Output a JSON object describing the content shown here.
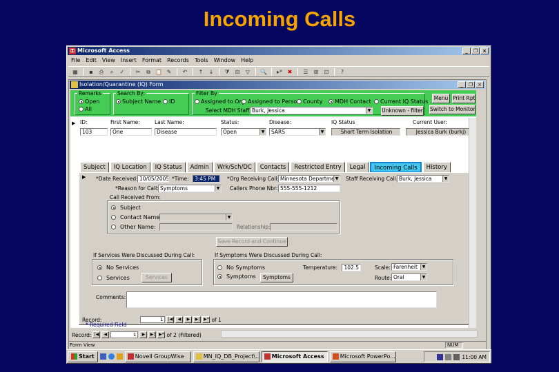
{
  "slide": {
    "title": "Incoming Calls"
  },
  "app": {
    "title": "Microsoft Access"
  },
  "menu": [
    "File",
    "Edit",
    "View",
    "Insert",
    "Format",
    "Records",
    "Tools",
    "Window",
    "Help"
  ],
  "form": {
    "title": "Isolation/Quarantine (IQ) Form",
    "header": {
      "remarks_label": "Remarks",
      "record_options": [
        {
          "label": "Open",
          "checked": true
        },
        {
          "label": "All",
          "checked": false
        }
      ],
      "search_by_label": "Search By:",
      "search_options": [
        {
          "label": "Subject Name",
          "checked": true
        },
        {
          "label": "ID",
          "checked": false
        }
      ],
      "filter_by_label": "Filter By",
      "filter_options": [
        {
          "label": "Assigned to Org",
          "checked": false
        },
        {
          "label": "Assigned to Person",
          "checked": false
        },
        {
          "label": "County",
          "checked": false
        },
        {
          "label": "MDH Contact",
          "checked": true
        },
        {
          "label": "Current IQ Status",
          "checked": false
        }
      ],
      "select_staff_label": "Select MDH Staff:",
      "select_staff_value": "Burk, Jessica",
      "unknown_button": "Unknown - filter",
      "menu_button": "Menu",
      "print_button": "Print Rpt",
      "monitoring_button": "Switch to Monitoring"
    },
    "record_header": {
      "columns": [
        "ID:",
        "First Name:",
        "Last Name:",
        "Status:",
        "Disease:",
        "IQ Status",
        "Current User:"
      ],
      "values": {
        "id": "103",
        "first_name": "One",
        "last_name": "Disease",
        "status": "Open",
        "disease": "SARS",
        "iq_status": "Short Term Isolation",
        "current_user": "Jessica Burk (burkj)"
      }
    },
    "tabs": [
      {
        "label": "Subject",
        "active": false
      },
      {
        "label": "IQ Location",
        "active": false
      },
      {
        "label": "IQ Status",
        "active": false
      },
      {
        "label": "Admin",
        "active": false
      },
      {
        "label": "Wrk/Sch/DC",
        "active": false
      },
      {
        "label": "Contacts",
        "active": false
      },
      {
        "label": "Restricted Entry",
        "active": false
      },
      {
        "label": "Legal",
        "active": false
      },
      {
        "label": "Incoming Calls",
        "active": true
      },
      {
        "label": "History",
        "active": false
      }
    ],
    "calls": {
      "date_label": "*Date Received:",
      "date_value": "10/05/2005",
      "time_label": "*Time:",
      "time_value": "3:45 PM",
      "org_label": "*Org Receiving Call:",
      "org_value": "Minnesota Department",
      "staff_label": "Staff Receiving Call:",
      "staff_value": "Burk, Jessica",
      "reason_label": "*Reason for Call:",
      "reason_value": "Symptoms",
      "phone_label": "Callers Phone Nbr:",
      "phone_value": "555-555-1212",
      "received_from_label": "Call Received From:",
      "received_from_options": [
        {
          "label": "Subject",
          "checked": true
        },
        {
          "label": "Contact Name:",
          "checked": false
        },
        {
          "label": "Other Name:",
          "checked": false
        }
      ],
      "relationship_label": "Relationship:",
      "save_button": "Save Record and Continue",
      "services_section": "If Services Were Discussed During Call:",
      "services_options": [
        {
          "label": "No Services",
          "checked": true
        },
        {
          "label": "Services",
          "checked": false
        }
      ],
      "services_button": "Services",
      "symptoms_section": "If Symptoms Were Discussed During Call:",
      "symptoms_options": [
        {
          "label": "No Symptoms",
          "checked": false
        },
        {
          "label": "Symptoms",
          "checked": true
        }
      ],
      "symptoms_button": "Symptoms",
      "temperature_label": "Temperature:",
      "temperature_value": "102.5",
      "scale_label": "Scale:",
      "scale_value": "Farenheit",
      "route_label": "Route:",
      "route_value": "Oral",
      "comments_label": "Comments:",
      "comments_value": ""
    },
    "subform_nav": {
      "label": "Record:",
      "current": "1",
      "total_text": "of 1"
    },
    "required_note": "* Required Field",
    "main_nav": {
      "label": "Record:",
      "current": "1",
      "total_text": "of 2 (Filtered)"
    }
  },
  "status": {
    "text": "Form View",
    "indicator": "NUM"
  },
  "taskbar": {
    "start": "Start",
    "tasks": [
      {
        "label": "Novell GroupWise",
        "active": false
      },
      {
        "label": "MN_IQ_DB_Project\\...",
        "active": false
      },
      {
        "label": "Microsoft Access",
        "active": true
      },
      {
        "label": "Microsoft PowerPo...",
        "active": false
      }
    ],
    "clock": "11:00 AM"
  }
}
